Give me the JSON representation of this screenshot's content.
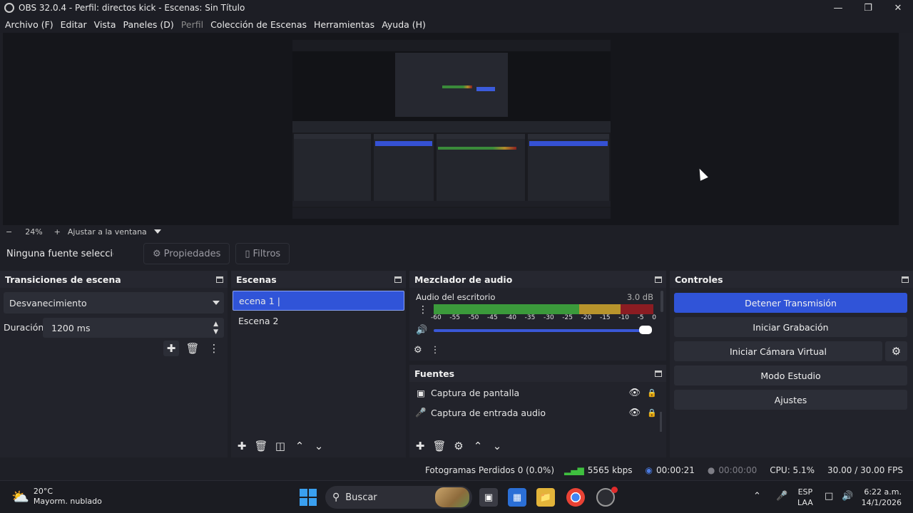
{
  "window": {
    "title": "OBS 32.0.4 - Perfil: directos kick - Escenas: Sin Título"
  },
  "menu": [
    "Archivo (F)",
    "Editar",
    "Vista",
    "Paneles (D)",
    "Perfil",
    "Colección de Escenas",
    "Herramientas",
    "Ayuda (H)"
  ],
  "zoom": {
    "minus": "−",
    "level": "24%",
    "plus": "+",
    "fit_label": "Ajustar a la ventana"
  },
  "source_toolbar": {
    "no_source": "Ninguna fuente seleccionada",
    "properties": "Propiedades",
    "filters": "Filtros"
  },
  "transitions": {
    "title": "Transiciones de escena",
    "selected": "Desvanecimiento",
    "duration_label": "Duración",
    "duration_value": "1200 ms"
  },
  "scenes": {
    "title": "Escenas",
    "items": [
      "ecena 1 |",
      "Escena 2"
    ],
    "selected_index": 0
  },
  "mixer": {
    "title": "Mezclador de audio",
    "channel": "Audio del escritorio",
    "db": "3.0 dB",
    "ticks": [
      "-60",
      "-55",
      "-50",
      "-45",
      "-40",
      "-35",
      "-30",
      "-25",
      "-20",
      "-15",
      "-10",
      "-5",
      "0"
    ],
    "volume_level": 1.0
  },
  "sources": {
    "title": "Fuentes",
    "items": [
      "Captura de pantalla",
      "Captura de entrada audio"
    ]
  },
  "controls": {
    "title": "Controles",
    "stop_stream": "Detener Transmisión",
    "start_recording": "Iniciar Grabación",
    "start_virtual_cam": "Iniciar Cámara Virtual",
    "studio_mode": "Modo Estudio",
    "settings": "Ajustes"
  },
  "status": {
    "dropped_frames": "Fotogramas Perdidos 0 (0.0%)",
    "bitrate": "5565 kbps",
    "stream_time": "00:00:21",
    "rec_time": "00:00:00",
    "cpu": "CPU: 5.1%",
    "fps": "30.00 / 30.00 FPS"
  },
  "taskbar": {
    "temp": "20°C",
    "weather": "Mayorm. nublado",
    "search": "Buscar",
    "lang_top": "ESP",
    "lang_bottom": "LAA",
    "time": "6:22 a.m.",
    "date": "14/1/2026"
  },
  "colors": {
    "accent": "#3054d8",
    "meter_green": "#3b9a3b",
    "meter_yellow": "#b8942c",
    "meter_red": "#8b1c22"
  }
}
